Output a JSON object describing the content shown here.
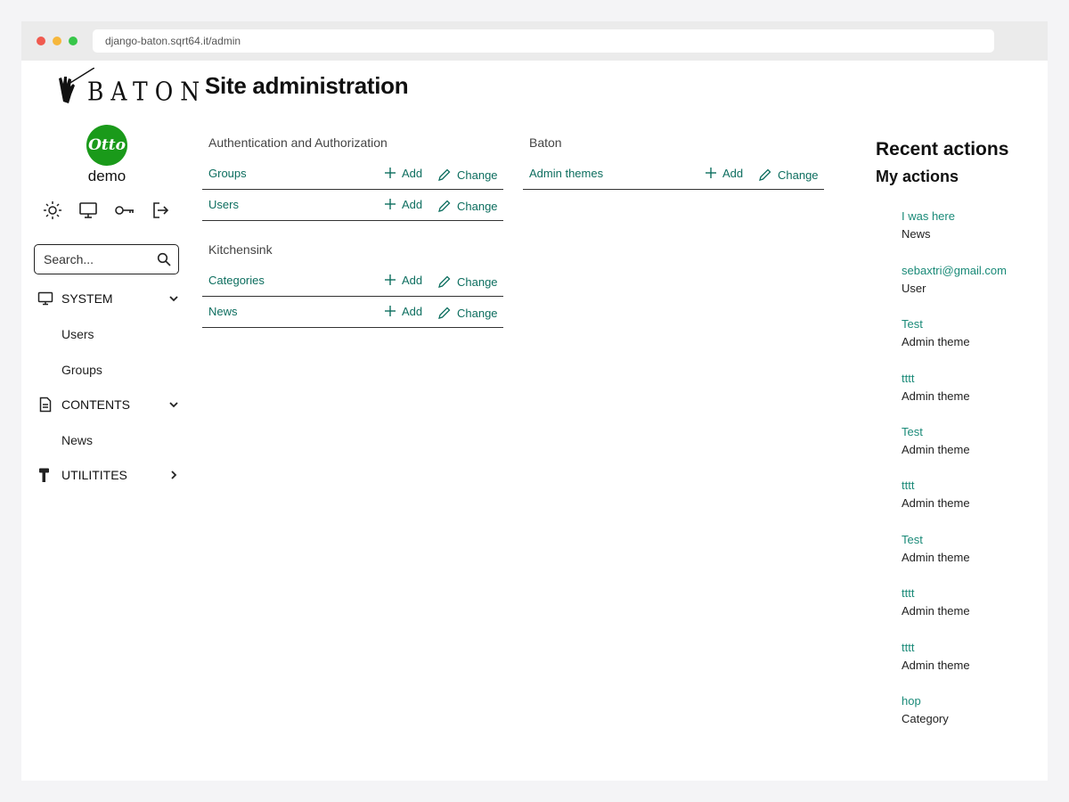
{
  "browser": {
    "url": "django-baton.sqrt64.it/admin",
    "dot_colors": [
      "#f05a4f",
      "#f6b73c",
      "#37c649"
    ]
  },
  "sidebar": {
    "logo_text": "BATON",
    "avatar_text": "Otto",
    "username": "demo",
    "tools": [
      "theme-toggle",
      "view-site",
      "change-password",
      "logout"
    ],
    "search_placeholder": "Search...",
    "sections": [
      {
        "label": "SYSTEM",
        "icon": "monitor-icon",
        "expanded": true,
        "items": [
          "Users",
          "Groups"
        ]
      },
      {
        "label": "CONTENTS",
        "icon": "document-icon",
        "expanded": true,
        "items": [
          "News"
        ]
      },
      {
        "label": "UTILITITES",
        "icon": "hammer-icon",
        "expanded": false,
        "items": []
      }
    ]
  },
  "main": {
    "title": "Site administration",
    "add_label": "Add",
    "change_label": "Change",
    "apps": [
      {
        "title": "Authentication and Authorization",
        "models": [
          "Groups",
          "Users"
        ]
      },
      {
        "title": "Kitchensink",
        "models": [
          "Categories",
          "News"
        ]
      },
      {
        "title": "Baton",
        "models": [
          "Admin themes"
        ]
      }
    ]
  },
  "recent": {
    "title": "Recent actions",
    "subtitle": "My actions",
    "actions": [
      {
        "name": "I was here",
        "type": "News"
      },
      {
        "name": "sebaxtri@gmail.com",
        "type": "User"
      },
      {
        "name": "Test",
        "type": "Admin theme"
      },
      {
        "name": "tttt",
        "type": "Admin theme"
      },
      {
        "name": "Test",
        "type": "Admin theme"
      },
      {
        "name": "tttt",
        "type": "Admin theme"
      },
      {
        "name": "Test",
        "type": "Admin theme"
      },
      {
        "name": "tttt",
        "type": "Admin theme"
      },
      {
        "name": "tttt",
        "type": "Admin theme"
      },
      {
        "name": "hop",
        "type": "Category"
      }
    ]
  },
  "colors": {
    "link": "#0d6e5f",
    "link_light": "#1a8a78",
    "avatar_bg": "#1a9a1a"
  }
}
